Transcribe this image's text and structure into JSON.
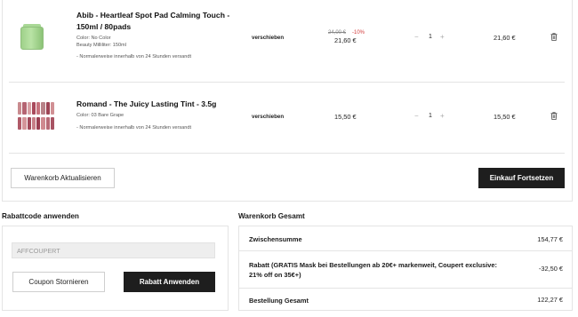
{
  "cart": {
    "items": [
      {
        "title": "Abib - Heartleaf Spot Pad Calming Touch - 150ml / 80pads",
        "meta": [
          "Color: No Color",
          "Beauty Milliliter: 150ml"
        ],
        "shipping": "- Normalerweise innerhalb von 24 Stunden versandt",
        "move_label": "verschieben",
        "price_old": "24,00 €",
        "discount_badge": "-10%",
        "price": "21,60 €",
        "quantity": "1",
        "total": "21,60 €"
      },
      {
        "title": "Romand - The Juicy Lasting Tint - 3.5g",
        "meta": [
          "Color: 03 Bare Grape"
        ],
        "shipping": "- Normalerweise innerhalb von 24 Stunden versandt",
        "move_label": "verschieben",
        "price": "15,50 €",
        "quantity": "1",
        "total": "15,50 €"
      }
    ],
    "update_button": "Warenkorb Aktualisieren",
    "continue_button": "Einkauf Fortsetzen"
  },
  "coupon": {
    "heading": "Rabattcode anwenden",
    "input_value": "AFFCOUPERT",
    "cancel_button": "Coupon Stornieren",
    "apply_button": "Rabatt Anwenden"
  },
  "totals": {
    "heading": "Warenkorb Gesamt",
    "subtotal_label": "Zwischensumme",
    "subtotal_value": "154,77 €",
    "discount_label": "Rabatt (GRATIS Mask bei Bestellungen ab 20€+ markenweit, Coupert exclusive: 21% off on 35€+)",
    "discount_value": "-32,50 €",
    "total_label": "Bestellung Gesamt",
    "total_value": "122,27 €"
  },
  "icons": {
    "trash": "trash-icon",
    "minus": "minus-icon",
    "plus": "plus-icon"
  },
  "colors": {
    "primary_button": "#1e1e1e",
    "discount_badge": "#d23c3c"
  }
}
